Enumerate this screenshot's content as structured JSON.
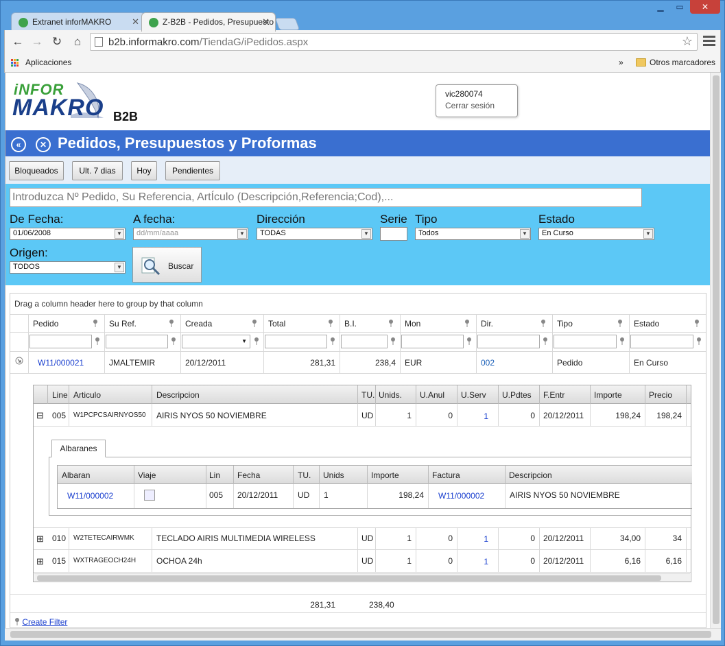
{
  "browser": {
    "tabs": [
      {
        "title": "Extranet inforMAKRO"
      },
      {
        "title": "Z-B2B - Pedidos, Presupuesto"
      }
    ],
    "url_host": "b2b.informakro.com",
    "url_path": "/TiendaG/iPedidos.aspx",
    "bookmarks": {
      "apps_label": "Aplicaciones",
      "overflow": "»",
      "other_label": "Otros marcadores"
    }
  },
  "header": {
    "logo_top": "iNFOR",
    "logo_bottom": "MAKRO",
    "b2b_label": "B2B",
    "user": "vic280074",
    "logout": "Cerrar sesión"
  },
  "title": "Pedidos, Presupuestos y Proformas",
  "quick_buttons": [
    "Bloqueados",
    "Ult. 7 dias",
    "Hoy",
    "Pendientes"
  ],
  "filters": {
    "search_placeholder": "Introduzca Nº Pedido, Su Referencia, ArtÍculo (Descripción,Referencia;Cod),...",
    "de_fecha_label": "De Fecha:",
    "de_fecha_value": "01/06/2008",
    "a_fecha_label": "A fecha:",
    "a_fecha_placeholder": "dd/mm/aaaa",
    "direccion_label": "Dirección",
    "direccion_value": "TODAS",
    "serie_label": "Serie",
    "tipo_label": "Tipo",
    "tipo_value": "Todos",
    "estado_label": "Estado",
    "estado_value": "En Curso",
    "origen_label": "Origen:",
    "origen_value": "TODOS",
    "buscar_label": "Buscar"
  },
  "grid": {
    "group_hint": "Drag a column header here to group by that column",
    "columns": [
      "Pedido",
      "Su Ref.",
      "Creada",
      "Total",
      "B.I.",
      "Mon",
      "Dir.",
      "Tipo",
      "Estado"
    ],
    "row": {
      "pedido": "W11/000021",
      "su_ref": "JMALTEMIR",
      "creada": "20/12/2011",
      "total": "281,31",
      "bi": "238,4",
      "mon": "EUR",
      "dir": "002",
      "tipo": "Pedido",
      "estado": "En Curso"
    },
    "detail": {
      "columns": [
        "Line",
        "Articulo",
        "Descripcion",
        "TU.",
        "Unids.",
        "U.Anul",
        "U.Serv",
        "U.Pdtes",
        "F.Entr",
        "Importe",
        "Precio"
      ],
      "lines": [
        {
          "line": "005",
          "articulo": "W1PCPCSAIRNYOS50",
          "descripcion": "AIRIS NYOS 50 NOVIEMBRE",
          "tu": "UD",
          "unids": "1",
          "uanul": "0",
          "userv": "1",
          "updtes": "0",
          "fentr": "20/12/2011",
          "importe": "198,24",
          "precio": "198,24",
          "expanded": "⊟"
        },
        {
          "line": "010",
          "articulo": "W2TETECAIRWMK",
          "descripcion": "TECLADO AIRIS MULTIMEDIA WIRELESS",
          "tu": "UD",
          "unids": "1",
          "uanul": "0",
          "userv": "1",
          "updtes": "0",
          "fentr": "20/12/2011",
          "importe": "34,00",
          "precio": "34",
          "expanded": "⊞"
        },
        {
          "line": "015",
          "articulo": "WXTRAGEOCH24H",
          "descripcion": "OCHOA 24h",
          "tu": "UD",
          "unids": "1",
          "uanul": "0",
          "userv": "1",
          "updtes": "0",
          "fentr": "20/12/2011",
          "importe": "6,16",
          "precio": "6,16",
          "expanded": "⊞"
        }
      ],
      "albaranes_tab": "Albaranes",
      "albaranes_columns": [
        "Albaran",
        "Viaje",
        "Lin",
        "Fecha",
        "TU.",
        "Unids",
        "Importe",
        "Factura",
        "Descripcion"
      ],
      "albaran": {
        "albaran": "W11/000002",
        "lin": "005",
        "fecha": "20/12/2011",
        "tu": "UD",
        "unids": "1",
        "importe": "198,24",
        "factura": "W11/000002",
        "descripcion": "AIRIS NYOS 50 NOVIEMBRE"
      }
    },
    "totals": {
      "total": "281,31",
      "bi": "238,40"
    },
    "create_filter": "Create Filter"
  }
}
